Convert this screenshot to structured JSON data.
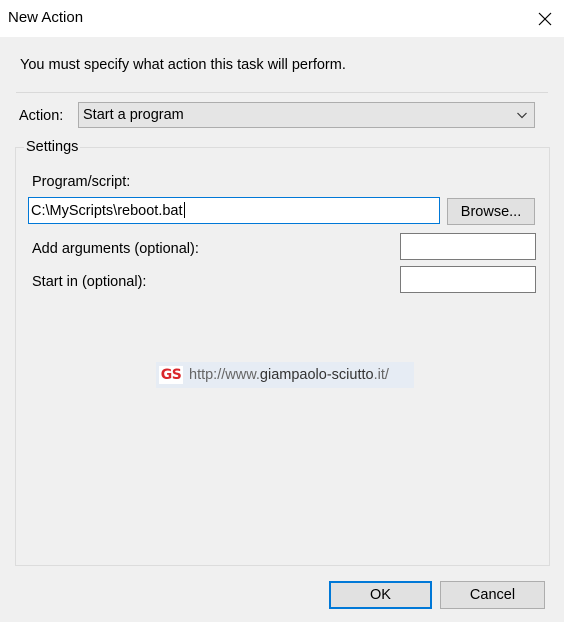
{
  "window": {
    "title": "New Action",
    "close_icon": "close-icon"
  },
  "instruction": "You must specify what action this task will perform.",
  "action": {
    "label": "Action:",
    "selected": "Start a program",
    "dropdown_icon": "chevron-down-icon"
  },
  "settings": {
    "legend": "Settings",
    "program": {
      "label": "Program/script:",
      "value": "C:\\MyScripts\\reboot.bat",
      "browse_label": "Browse..."
    },
    "arguments": {
      "label": "Add arguments (optional):",
      "value": ""
    },
    "start_in": {
      "label": "Start in (optional):",
      "value": ""
    }
  },
  "watermark": {
    "logo_text": "GS",
    "url_prefix": "http://www.",
    "url_domain": "giampaolo-sciutto",
    "url_suffix": ".it/",
    "logo_color": "#d9262b"
  },
  "buttons": {
    "ok": "OK",
    "cancel": "Cancel"
  },
  "colors": {
    "focus_accent": "#0078d7",
    "background": "#f0f0f0"
  }
}
